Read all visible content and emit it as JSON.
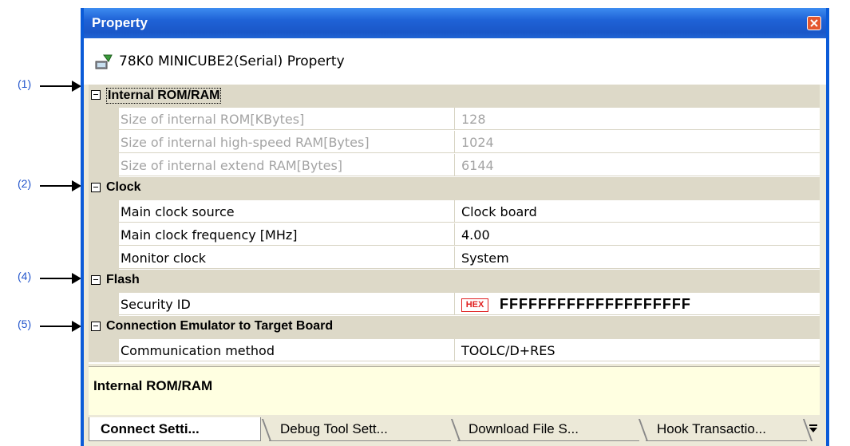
{
  "annotations": [
    "(1)",
    "(2)",
    "(4)",
    "(5)"
  ],
  "window": {
    "title": "Property",
    "header": "78K0 MINICUBE2(Serial) Property"
  },
  "categories": {
    "internal_rom_ram": "Internal ROM/RAM",
    "clock": "Clock",
    "flash": "Flash",
    "connection": "Connection Emulator to Target Board"
  },
  "properties": {
    "rom_size": {
      "name": "Size of internal ROM[KBytes]",
      "value": "128"
    },
    "hs_ram_size": {
      "name": "Size of internal high-speed RAM[Bytes]",
      "value": "1024"
    },
    "ext_ram_size": {
      "name": "Size of internal extend RAM[Bytes]",
      "value": "6144"
    },
    "main_clock_source": {
      "name": "Main clock source",
      "value": "Clock board"
    },
    "main_clock_freq": {
      "name": "Main clock frequency [MHz]",
      "value": "4.00"
    },
    "monitor_clock": {
      "name": "Monitor clock",
      "value": "System"
    },
    "security_id": {
      "name": "Security ID",
      "badge": "HEX",
      "value": "FFFFFFFFFFFFFFFFFFFF"
    },
    "comm_method": {
      "name": "Communication method",
      "value": "TOOLC/D+RES"
    }
  },
  "description": "Internal ROM/RAM",
  "tabs": [
    "Connect Setti...",
    "Debug Tool Sett...",
    "Download File S...",
    "Hook Transactio..."
  ],
  "colors": {
    "titlebar": "#1f62d6",
    "annotation": "#2255cc",
    "hex_badge": "#e02020"
  }
}
